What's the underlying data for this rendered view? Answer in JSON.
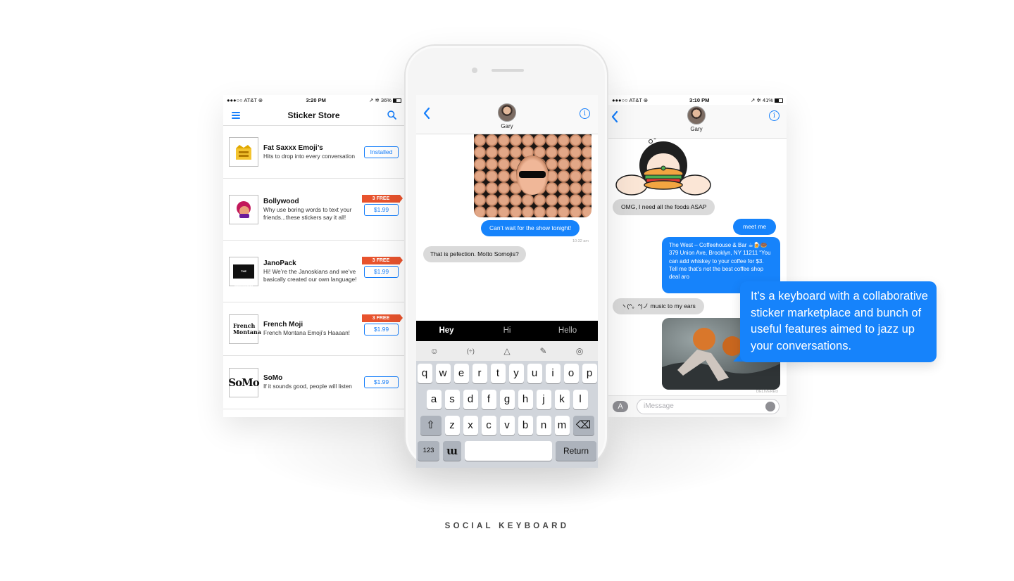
{
  "footer": {
    "label": "SOCIAL KEYBOARD"
  },
  "callout": {
    "text": "It’s a keyboard with a collaborative sticker marketplace and bunch of useful features aimed to jazz up your conversations."
  },
  "left_screen": {
    "status": {
      "carrier": "●●●○○ AT&T ⊕",
      "time": "3:20 PM",
      "battery": "↗ ✲ 36%"
    },
    "nav": {
      "title": "Sticker Store",
      "menu_icon": "hamburger-icon",
      "search_icon": "search-icon"
    },
    "items": [
      {
        "name": "Fat Saxxx Emoji’s",
        "desc": "Hits to drop into every conversation",
        "action": "Installed",
        "badge": ""
      },
      {
        "name": "Bollywood",
        "desc": "Why use boring words to text your friends...these stickers say it all!",
        "action": "$1.99",
        "badge": "3 FREE"
      },
      {
        "name": "JanoPack",
        "desc": "Hi! We’re the Janoskians and we’ve basically created our own language!",
        "action": "$1.99",
        "badge": "3 FREE",
        "thumb_text": "THE JANOSKIANS"
      },
      {
        "name": "French Moji",
        "desc": "French Montana Emoji’s Haaaan!",
        "action": "$1.99",
        "badge": "3 FREE",
        "thumb_text": "French Montana"
      },
      {
        "name": "SoMo",
        "desc": "If it sounds good, people will listen",
        "action": "$1.99",
        "badge": "",
        "thumb_text": "SoMo"
      }
    ],
    "accent": "#147efb",
    "badge_color": "#e8532d"
  },
  "center_phone": {
    "contact": "Gary",
    "messages": [
      {
        "text": "Can’t wait for the show tonight!",
        "from": "me"
      },
      {
        "text": "That is pefection. Motto Somojis?",
        "from": "them"
      }
    ],
    "timestamp": "10:32 am",
    "suggestions": [
      "Hey",
      "Hi",
      "Hello"
    ],
    "tool_icons": [
      "sticker-icon",
      "kaomoji-icon",
      "gif-icon",
      "draw-icon",
      "location-icon"
    ],
    "tool_glyphs": [
      "☺",
      "(÷)",
      "△",
      "✎",
      "◎"
    ],
    "keys": {
      "row1": [
        "q",
        "w",
        "e",
        "r",
        "t",
        "y",
        "u",
        "i",
        "o",
        "p"
      ],
      "row2": [
        "a",
        "s",
        "d",
        "f",
        "g",
        "h",
        "j",
        "k",
        "l"
      ],
      "row3": [
        "z",
        "x",
        "c",
        "v",
        "b",
        "n",
        "m"
      ],
      "shift": "⇧",
      "delete": "⌫",
      "numbers": "123",
      "logo": "ɯ",
      "return": "Return"
    }
  },
  "right_screen": {
    "status": {
      "carrier": "●●●○○ AT&T ⊕",
      "time": "3:10 PM",
      "battery": "↗ ✲ 41%"
    },
    "contact": "Gary",
    "messages": [
      {
        "text": "OMG, I need all the foods ASAP",
        "from": "them"
      },
      {
        "text": "meet me",
        "from": "me"
      },
      {
        "text": "The West – Coffeehouse & Bar ☕🍺🍩 379 Union Ave, Brooklyn, NY 11211 “You can add whiskey to your coffee for $3. Tell me that’s not the best coffee shop deal aro",
        "from": "me"
      },
      {
        "text": "ヽ(^。^)ノ music to my ears",
        "from": "them"
      }
    ],
    "delivered": "DELIVERED",
    "input_placeholder": "iMessage"
  }
}
